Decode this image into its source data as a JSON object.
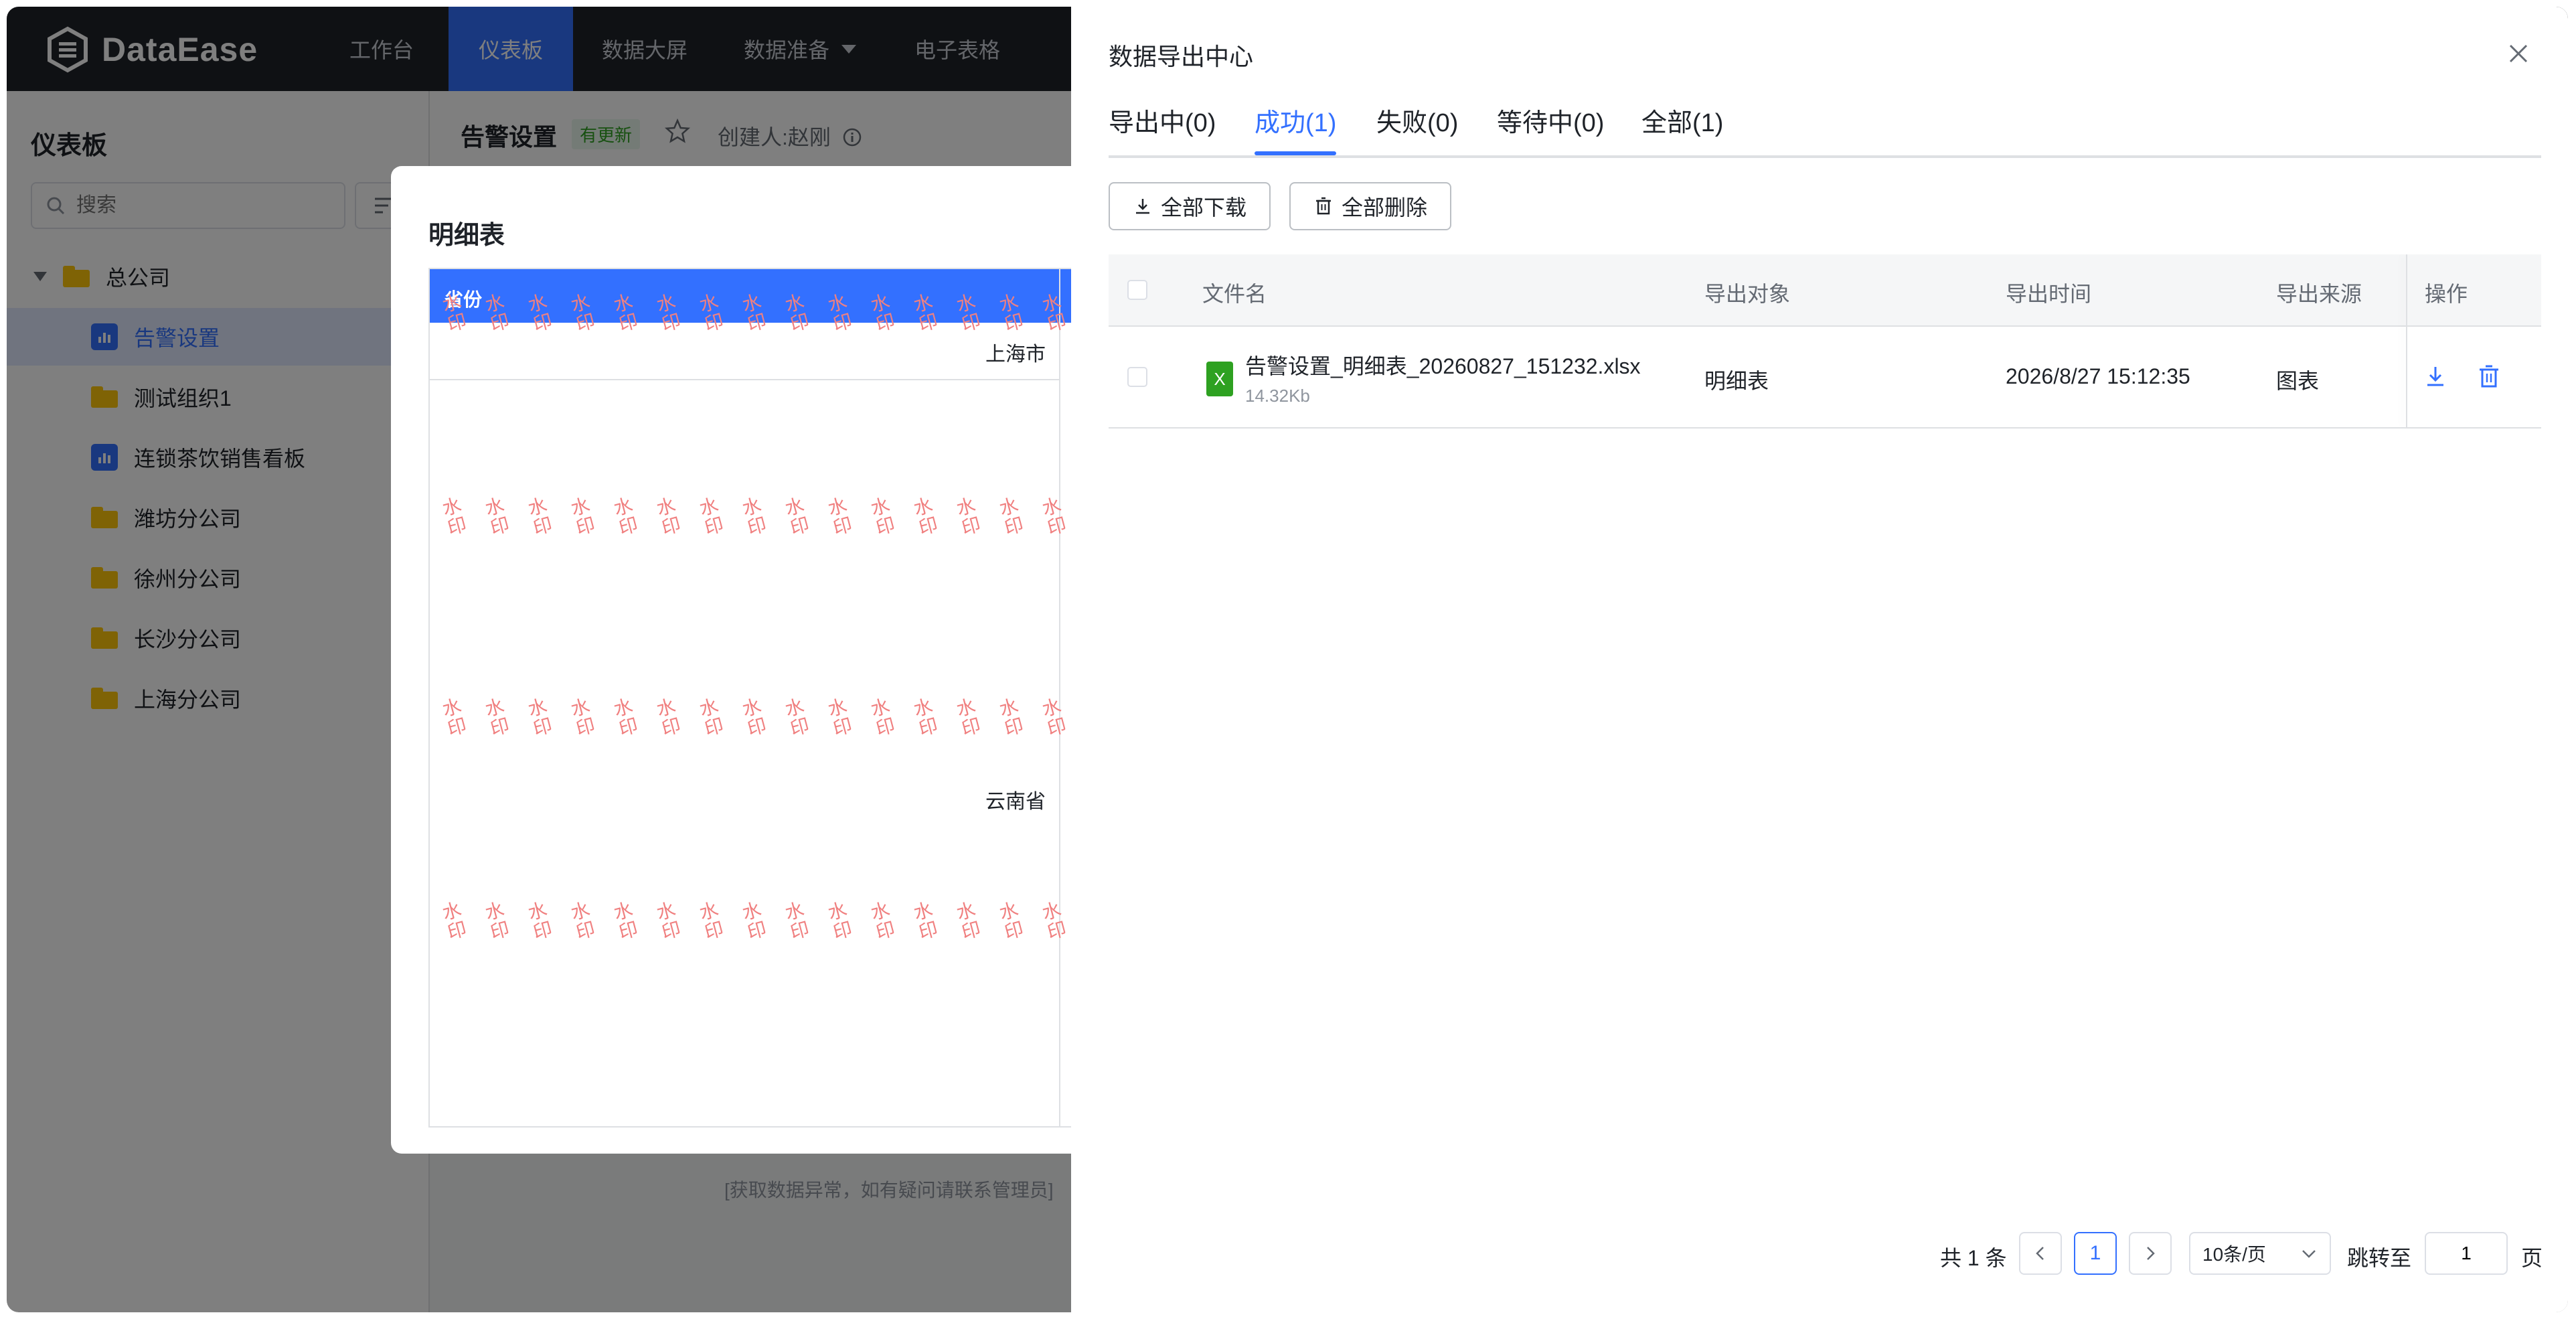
{
  "app": {
    "brand": "DataEase",
    "nav": [
      {
        "label": "工作台"
      },
      {
        "label": "仪表板"
      },
      {
        "label": "数据大屏"
      },
      {
        "label": "数据准备"
      },
      {
        "label": "电子表格"
      }
    ]
  },
  "sidebar": {
    "title": "仪表板",
    "search_placeholder": "搜索",
    "items": [
      {
        "label": "总公司"
      },
      {
        "label": "告警设置"
      },
      {
        "label": "测试组织1"
      },
      {
        "label": "连锁茶饮销售看板"
      },
      {
        "label": "潍坊分公司"
      },
      {
        "label": "徐州分公司"
      },
      {
        "label": "长沙分公司"
      },
      {
        "label": "上海分公司"
      }
    ]
  },
  "dashboard": {
    "title": "告警设置",
    "badge": "有更新",
    "creator": "创建人:赵刚",
    "watermark": "水印",
    "bottom_note": "[获取数据异常，如有疑问请联系管理员]"
  },
  "detail_dialog": {
    "title": "明细表",
    "column": "省份",
    "rows": [
      "上海市",
      "云南省"
    ]
  },
  "export_center": {
    "title": "数据导出中心",
    "tabs": [
      {
        "label": "导出中(0)"
      },
      {
        "label": "成功(1)"
      },
      {
        "label": "失败(0)"
      },
      {
        "label": "等待中(0)"
      },
      {
        "label": "全部(1)"
      }
    ],
    "active_tab": "成功(1)",
    "download_all": "全部下载",
    "delete_all": "全部删除",
    "columns": {
      "filename": "文件名",
      "object": "导出对象",
      "time": "导出时间",
      "source": "导出来源",
      "ops": "操作"
    },
    "rows": [
      {
        "file_type": "X",
        "filename": "告警设置_明细表_20260827_151232.xlsx",
        "size": "14.32Kb",
        "object": "明细表",
        "time": "2026/8/27 15:12:35",
        "source": "图表"
      }
    ],
    "pagination": {
      "total": "共 1 条",
      "current_page": "1",
      "page_size": "10条/页",
      "jump_label": "跳转至",
      "jump_value": "1",
      "page_suffix": "页"
    }
  },
  "colors": {
    "accent": "#3370ff",
    "nav_bg": "#1f2329",
    "success": "#2ea121",
    "folder": "#ffc60a",
    "watermark": "#e63a3a"
  }
}
